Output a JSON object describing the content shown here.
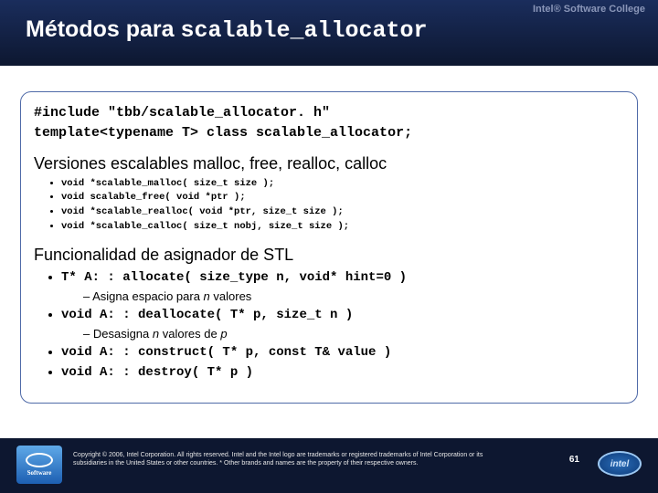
{
  "header": {
    "college": "Intel® Software College",
    "title_plain": "Métodos para ",
    "title_mono": "scalable_allocator"
  },
  "include": {
    "line1": "#include \"tbb/scalable_allocator. h\"",
    "line2": "template<typename T> class scalable_allocator;"
  },
  "section1": {
    "heading": "Versiones escalables malloc, free, realloc, calloc",
    "items": [
      "void *scalable_malloc( size_t size );",
      "void scalable_free( void *ptr );",
      "void *scalable_realloc( void *ptr, size_t size );",
      "void *scalable_calloc( size_t nobj, size_t size );"
    ]
  },
  "section2": {
    "heading": "Funcionalidad de asignador de STL",
    "items": [
      {
        "code": "T* A: : allocate( size_type n, void* hint=0 )",
        "sub_prefix": "– Asigna espacio para ",
        "sub_em": "n",
        "sub_suffix": " valores"
      },
      {
        "code": "void A: : deallocate( T* p, size_t n )",
        "sub_prefix": "– Desasigna ",
        "sub_em": "n",
        "sub_suffix": " valores de ",
        "sub_em2": "p"
      },
      {
        "code": "void A: : construct( T* p, const T& value )"
      },
      {
        "code": "void A: : destroy( T* p )"
      }
    ]
  },
  "footer": {
    "software_label": "Software",
    "copyright": "Copyright © 2006, Intel Corporation. All rights reserved.\nIntel and the Intel logo are trademarks or registered trademarks of Intel Corporation or its subsidiaries in the United States or other countries. * Other brands and names are the property of their respective owners.",
    "page": "61",
    "intel": "intel"
  }
}
